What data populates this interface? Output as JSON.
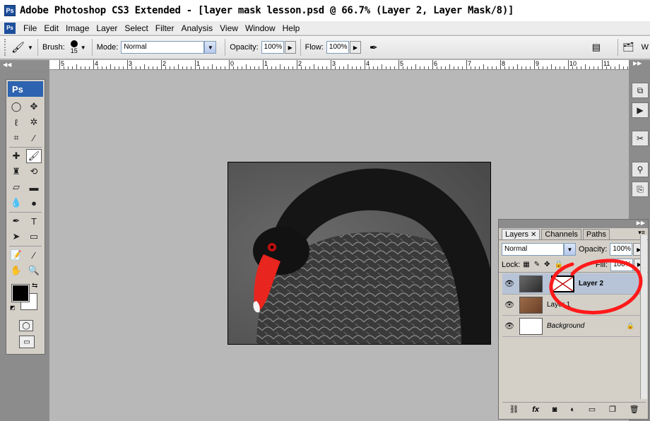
{
  "window": {
    "title": "Adobe Photoshop CS3 Extended - [layer mask lesson.psd @ 66.7% (Layer 2, Layer Mask/8)]",
    "app_icon": "Ps"
  },
  "menu": {
    "items": [
      "File",
      "Edit",
      "Image",
      "Layer",
      "Select",
      "Filter",
      "Analysis",
      "View",
      "Window",
      "Help"
    ]
  },
  "options": {
    "brush_label": "Brush:",
    "brush_size": "15",
    "mode_label": "Mode:",
    "mode_value": "Normal",
    "opacity_label": "Opacity:",
    "opacity_value": "100%",
    "flow_label": "Flow:",
    "flow_value": "100%",
    "workspace_letter": "W"
  },
  "ruler": {
    "labels": [
      "5",
      "4",
      "3",
      "2",
      "1",
      "0",
      "1",
      "2",
      "3",
      "4",
      "5",
      "6",
      "7",
      "8",
      "9",
      "10",
      "11"
    ]
  },
  "toolbox": {
    "logo": "Ps"
  },
  "layers_panel": {
    "tabs": [
      "Layers",
      "Channels",
      "Paths"
    ],
    "blend_mode": "Normal",
    "opacity_label": "Opacity:",
    "opacity_value": "100%",
    "lock_label": "Lock:",
    "fill_label": "Fill:",
    "fill_value": "100%",
    "layers": [
      {
        "name": "Layer 2",
        "selected": true
      },
      {
        "name": "Layer 1",
        "selected": false
      },
      {
        "name": "Background",
        "selected": false
      }
    ]
  },
  "colors": {
    "annotation_circle": "#ff1a1a",
    "selection": "#b7c4d8",
    "canvas_bg": "#b8b8b8"
  }
}
